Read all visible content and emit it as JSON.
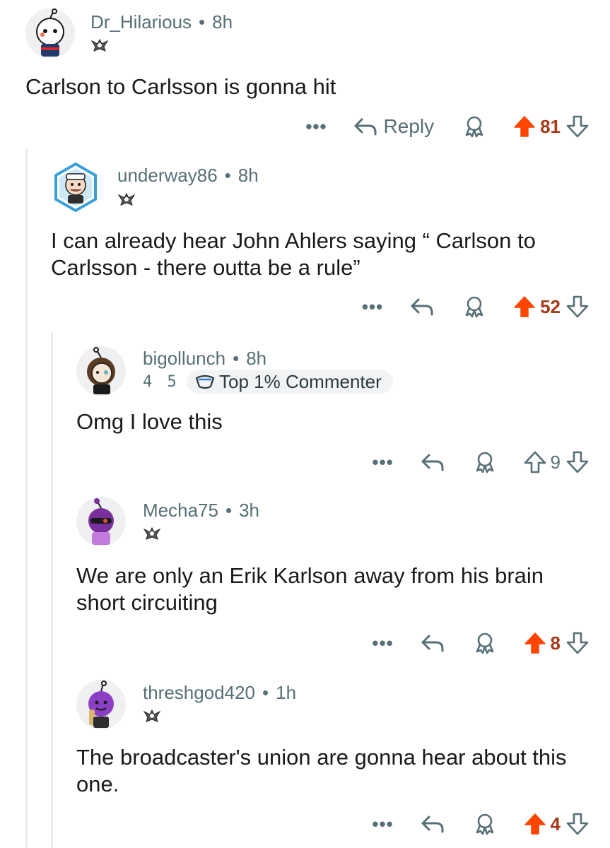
{
  "comments": [
    {
      "username": "Dr_Hilarious",
      "age": "8h",
      "text": "Carlson to Carlsson is gonna hit",
      "reply_label": "Reply",
      "score": "81",
      "voted": "up"
    },
    {
      "username": "underway86",
      "age": "8h",
      "text": "I can already hear John Ahlers saying “ Carlson to Carlsson - there outta be a rule”",
      "score": "52",
      "voted": "up"
    },
    {
      "username": "bigollunch",
      "age": "8h",
      "flair_text": "4 5",
      "badge": "Top 1% Commenter",
      "text": "Omg I love this",
      "score": "9",
      "voted": "none"
    },
    {
      "username": "Mecha75",
      "age": "3h",
      "text": "We are only an Erik Karlson away from his brain short circuiting",
      "score": "8",
      "voted": "up"
    },
    {
      "username": "threshgod420",
      "age": "1h",
      "text": "The broadcaster's union are gonna hear about this one.",
      "score": "4",
      "voted": "up"
    }
  ],
  "icons": {
    "more": "more-dots-icon",
    "reply": "reply-arrow-icon",
    "award": "award-icon",
    "upvote": "upvote-arrow-icon",
    "downvote": "downvote-arrow-icon",
    "flair": "ducks-logo-icon"
  },
  "colors": {
    "upvote_active": "#ff4500",
    "score_active": "#a63a18",
    "meta_text": "#576f76",
    "thread_line": "#e9ebed"
  },
  "more_label": "•••"
}
